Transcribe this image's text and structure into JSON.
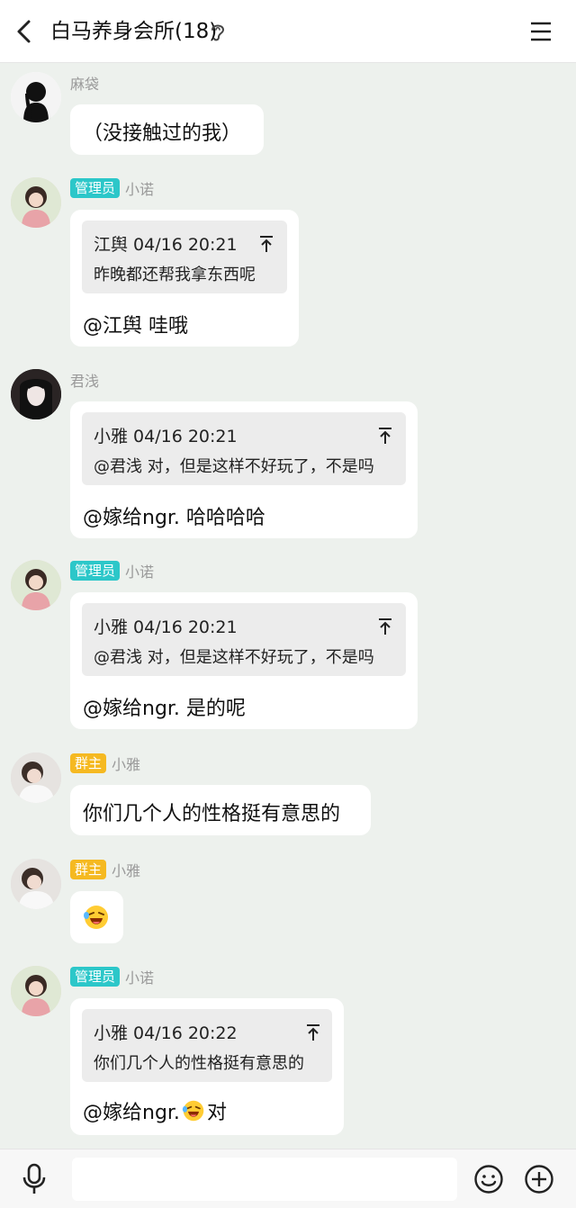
{
  "header": {
    "title": "白马养身会所(18)",
    "back_icon": "back-arrow-icon",
    "ear_icon": "ear-icon",
    "menu_icon": "menu-icon"
  },
  "colors": {
    "background": "#edf1ed",
    "admin_badge": "#2cc7c9",
    "owner_badge": "#f5b921"
  },
  "messages": [
    {
      "sender": "麻袋",
      "badge": "",
      "text": "（没接触过的我）"
    },
    {
      "sender": "小诺",
      "badge": "管理员",
      "quote": {
        "head": "江舆 04/16 20:21",
        "body": "昨晚都还帮我拿东西呢"
      },
      "text": "@江舆 哇哦"
    },
    {
      "sender": "君浅",
      "badge": "",
      "quote": {
        "head": "小雅 04/16 20:21",
        "body": "@君浅 对，但是这样不好玩了，不是吗"
      },
      "text": "@嫁给ngr. 哈哈哈哈"
    },
    {
      "sender": "小诺",
      "badge": "管理员",
      "quote": {
        "head": "小雅 04/16 20:21",
        "body": "@君浅 对，但是这样不好玩了，不是吗"
      },
      "text": "@嫁给ngr. 是的呢"
    },
    {
      "sender": "小雅",
      "badge": "群主",
      "text": "你们几个人的性格挺有意思的"
    },
    {
      "sender": "小雅",
      "badge": "群主",
      "text": "",
      "emoji": "laughing-face-emoji"
    },
    {
      "sender": "小诺",
      "badge": "管理员",
      "quote": {
        "head": "小雅 04/16 20:22",
        "body": "你们几个人的性格挺有意思的"
      },
      "text_before": "@嫁给ngr.",
      "text_after": "对",
      "emoji": "laughing-face-emoji"
    }
  ],
  "bottom_bar": {
    "mic_icon": "microphone-icon",
    "emoji_icon": "smiley-icon",
    "plus_icon": "plus-icon",
    "input_placeholder": ""
  }
}
